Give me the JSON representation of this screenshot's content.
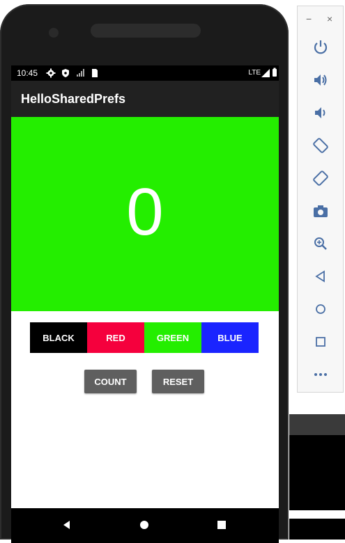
{
  "status_bar": {
    "time": "10:45",
    "network": "LTE",
    "icons": [
      "gear-icon",
      "shield-icon",
      "sim-card-icon",
      "signal-icon",
      "battery-icon"
    ]
  },
  "app": {
    "title": "HelloSharedPrefs",
    "count": "0",
    "panel_color": "#24ee00"
  },
  "color_buttons": [
    {
      "label": "BLACK",
      "color": "#000000"
    },
    {
      "label": "RED",
      "color": "#f5003d"
    },
    {
      "label": "GREEN",
      "color": "#24ee00"
    },
    {
      "label": "BLUE",
      "color": "#1a24ff"
    }
  ],
  "actions": {
    "count_label": "COUNT",
    "reset_label": "RESET"
  },
  "nav": [
    "back-icon",
    "home-icon",
    "recents-icon"
  ],
  "emulator_toolbar": {
    "minimize": "−",
    "close": "×",
    "buttons": [
      "power-icon",
      "volume-up-icon",
      "volume-down-icon",
      "rotate-left-icon",
      "rotate-right-icon",
      "camera-icon",
      "zoom-icon",
      "back-icon",
      "home-icon",
      "overview-icon",
      "more-icon"
    ]
  }
}
